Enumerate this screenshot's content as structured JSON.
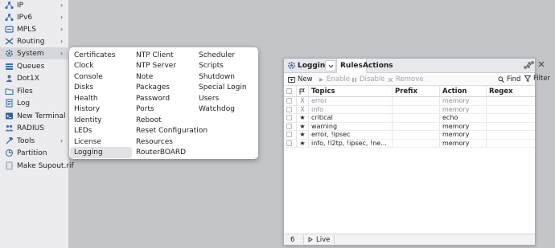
{
  "sidebar": {
    "items": [
      {
        "label": "IP",
        "icon": "ip-icon",
        "arrow": "›"
      },
      {
        "label": "IPv6",
        "icon": "ipv6-icon",
        "arrow": "›"
      },
      {
        "label": "MPLS",
        "icon": "mpls-icon",
        "arrow": "›"
      },
      {
        "label": "Routing",
        "icon": "routing-icon",
        "arrow": "›"
      },
      {
        "label": "System",
        "icon": "gear-icon",
        "arrow": "›"
      },
      {
        "label": "Queues",
        "icon": "queues-icon"
      },
      {
        "label": "Dot1X",
        "icon": "dot1x-icon"
      },
      {
        "label": "Files",
        "icon": "folder-icon"
      },
      {
        "label": "Log",
        "icon": "log-icon"
      },
      {
        "label": "New Terminal",
        "icon": "terminal-icon"
      },
      {
        "label": "RADIUS",
        "icon": "radius-icon"
      },
      {
        "label": "Tools",
        "icon": "tools-icon",
        "arrow": "›"
      },
      {
        "label": "Partition",
        "icon": "partition-icon"
      },
      {
        "label": "Make Supout.rif",
        "icon": "supout-icon"
      }
    ]
  },
  "submenu": {
    "columns": [
      [
        "Certificates",
        "Clock",
        "Console",
        "Disks",
        "Health",
        "History",
        "Identity",
        "LEDs",
        "License",
        "Logging"
      ],
      [
        "NTP Client",
        "NTP Server",
        "Note",
        "Packages",
        "Password",
        "Ports",
        "Reboot",
        "Reset Configuration",
        "Resources",
        "RouterBOARD"
      ],
      [
        "Scheduler",
        "Scripts",
        "Shutdown",
        "Special Login",
        "Users",
        "Watchdog"
      ]
    ]
  },
  "window": {
    "title": "Logging",
    "tabs": [
      "Rules",
      "Actions"
    ],
    "toolbar": {
      "new": "New",
      "enable": "Enable",
      "disable": "Disable",
      "remove": "Remove",
      "find": "Find",
      "filter": "Filter"
    },
    "columns": [
      "Topics",
      "Prefix",
      "Action",
      "Regex"
    ],
    "rows": [
      {
        "flag": "X",
        "topics": "error",
        "prefix": "",
        "action": "memory",
        "regex": "",
        "disabled": true
      },
      {
        "flag": "X",
        "topics": "info",
        "prefix": "",
        "action": "memory",
        "regex": "",
        "disabled": true
      },
      {
        "flag": "★",
        "topics": "critical",
        "prefix": "",
        "action": "echo",
        "regex": "",
        "disabled": false
      },
      {
        "flag": "★",
        "topics": "warning",
        "prefix": "",
        "action": "memory",
        "regex": "",
        "disabled": false
      },
      {
        "flag": "★",
        "topics": "error, !ipsec",
        "prefix": "",
        "action": "memory",
        "regex": "",
        "disabled": false
      },
      {
        "flag": "★",
        "topics": "info, !l2tp, !ipsec, !ne...",
        "prefix": "",
        "action": "memory",
        "regex": "",
        "disabled": false
      }
    ],
    "status": {
      "count": "6",
      "live": "Live"
    }
  }
}
